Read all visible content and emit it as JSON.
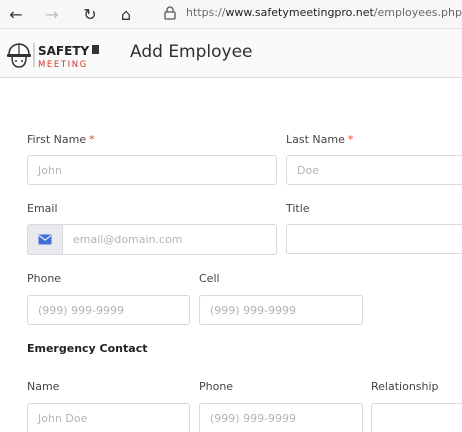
{
  "browser": {
    "url_prefix": "https://",
    "url_domain": "www.safetymeetingpro.net",
    "url_path": "/employees.php"
  },
  "app": {
    "page_title": "Add Employee",
    "logo_text_top": "SAFETY",
    "logo_text_bottom": "MEETING"
  },
  "form": {
    "first_name": {
      "label": "First Name",
      "required_mark": "*",
      "placeholder": "John"
    },
    "last_name": {
      "label": "Last Name",
      "required_mark": "*",
      "placeholder": "Doe"
    },
    "email": {
      "label": "Email",
      "placeholder": "email@domain.com"
    },
    "title": {
      "label": "Title",
      "placeholder": ""
    },
    "phone": {
      "label": "Phone",
      "placeholder": "(999) 999-9999"
    },
    "cell": {
      "label": "Cell",
      "placeholder": "(999) 999-9999"
    },
    "emergency": {
      "section_title": "Emergency Contact",
      "name": {
        "label": "Name",
        "placeholder": "John Doe"
      },
      "phone": {
        "label": "Phone",
        "placeholder": "(999) 999-9999"
      },
      "relationship": {
        "label": "Relationship",
        "placeholder": ""
      }
    }
  },
  "colors": {
    "required": "#e0483d",
    "icon_blue": "#3f6fd8",
    "logo_red": "#d0352b"
  }
}
